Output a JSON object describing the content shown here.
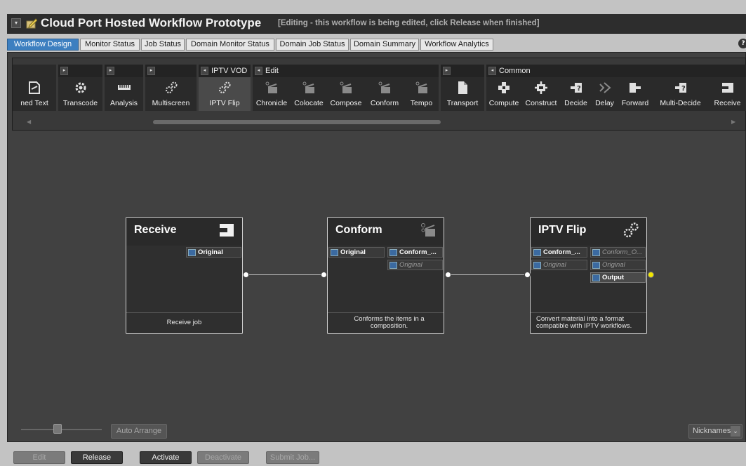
{
  "title": {
    "text": "Cloud Port Hosted Workflow Prototype",
    "note": "[Editing - this workflow is being edited, click Release when finished]"
  },
  "tabs": [
    {
      "label": "Workflow Design",
      "active": true
    },
    {
      "label": "Monitor Status"
    },
    {
      "label": "Job Status"
    },
    {
      "label": "Domain Monitor Status"
    },
    {
      "label": "Domain Job Status"
    },
    {
      "label": "Domain Summary"
    },
    {
      "label": "Workflow Analytics"
    }
  ],
  "help_icon": "?",
  "palette": {
    "groups": [
      {
        "header": "",
        "tools": [
          {
            "label": "ned Text",
            "icon": "file-text-icon"
          }
        ]
      },
      {
        "header": "",
        "tools": [
          {
            "label": "Transcode",
            "icon": "gear-icon"
          }
        ]
      },
      {
        "header": "",
        "tools": [
          {
            "label": "Analysis",
            "icon": "meter-icon"
          }
        ]
      },
      {
        "header": "",
        "tools": [
          {
            "label": "Multiscreen",
            "icon": "gears-icon"
          }
        ]
      },
      {
        "header": "IPTV VOD",
        "tools": [
          {
            "label": "IPTV Flip",
            "icon": "gears-icon",
            "selected": true
          }
        ]
      },
      {
        "header": "Edit",
        "tools": [
          {
            "label": "Chronicle",
            "icon": "clapper-icon"
          },
          {
            "label": "Colocate",
            "icon": "clapper-icon"
          },
          {
            "label": "Compose",
            "icon": "clapper-icon"
          },
          {
            "label": "Conform",
            "icon": "clapper-icon"
          },
          {
            "label": "Tempo",
            "icon": "clapper-icon"
          }
        ]
      },
      {
        "header": "",
        "tools": [
          {
            "label": "Transport",
            "icon": "document-icon"
          }
        ]
      },
      {
        "header": "Common",
        "tools": [
          {
            "label": "Compute",
            "icon": "compute-icon"
          },
          {
            "label": "Construct",
            "icon": "construct-icon"
          },
          {
            "label": "Decide",
            "icon": "decide-icon"
          },
          {
            "label": "Delay",
            "icon": "delay-icon"
          },
          {
            "label": "Forward",
            "icon": "forward-icon"
          },
          {
            "label": "Multi-Decide",
            "icon": "multi-decide-icon"
          },
          {
            "label": "Receive",
            "icon": "receive-icon"
          }
        ]
      }
    ]
  },
  "nodes": [
    {
      "title": "Receive",
      "icon": "receive-icon",
      "description": "Receive job",
      "ports_left": [],
      "ports_right": [
        {
          "label": "Original",
          "style": "bold"
        }
      ]
    },
    {
      "title": "Conform",
      "icon": "clapper-icon",
      "description": "Conforms the items in a composition.",
      "ports_left": [
        {
          "label": "Original",
          "style": "bold"
        }
      ],
      "ports_right": [
        {
          "label": "Conform_...",
          "style": "bold"
        },
        {
          "label": "Original",
          "style": "ital"
        }
      ]
    },
    {
      "title": "IPTV Flip",
      "icon": "gears-icon",
      "description": "Convert material into a format compatible with IPTV workflows.",
      "ports_left": [
        {
          "label": "Conform_...",
          "style": "bold"
        },
        {
          "label": "Original",
          "style": "ital"
        }
      ],
      "ports_right": [
        {
          "label": "Conform_O...",
          "style": "ital"
        },
        {
          "label": "Original",
          "style": "ital"
        },
        {
          "label": "Output",
          "style": "bold",
          "active": true
        }
      ]
    }
  ],
  "controls": {
    "auto_arrange": "Auto Arrange",
    "nicknames": "Nicknames",
    "zoom_level": 0.45
  },
  "bottom_buttons": [
    {
      "label": "Edit",
      "enabled": false
    },
    {
      "label": "Release",
      "enabled": true
    },
    {
      "label": "Activate",
      "enabled": true
    },
    {
      "label": "Deactivate",
      "enabled": false
    },
    {
      "label": "Submit Job...",
      "enabled": false
    }
  ],
  "colors": {
    "active_tab": "#3d7fc0",
    "output_connector": "#f2e600"
  }
}
